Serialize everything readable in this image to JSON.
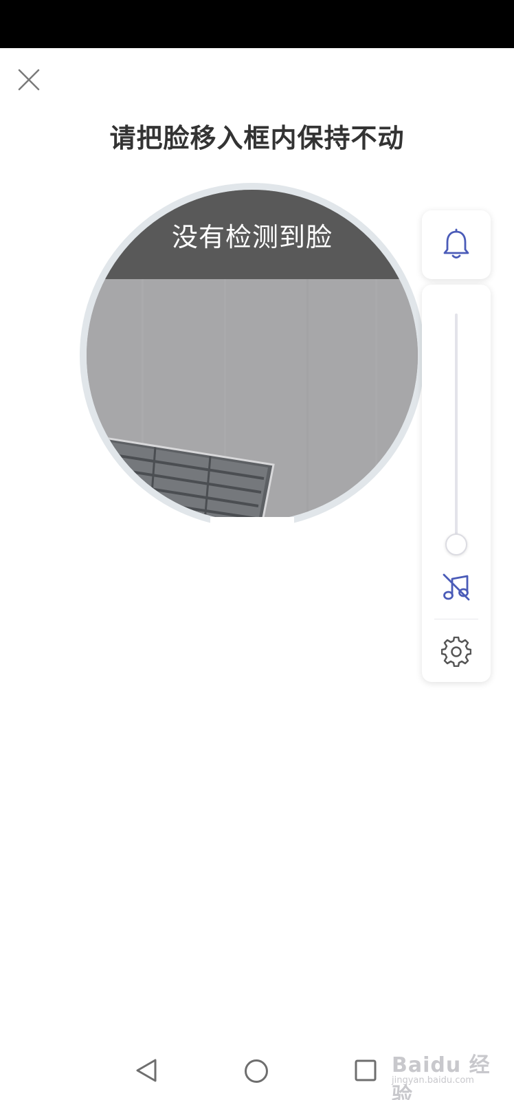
{
  "header": {
    "title": "请把脸移入框内保持不动"
  },
  "face_frame": {
    "status_text": "没有检测到脸"
  },
  "controls": {
    "bell_icon": "bell-icon",
    "volume_level": 0,
    "mute_icon": "music-off-icon",
    "settings_icon": "gear-icon"
  },
  "navigation": {
    "back_icon": "back-triangle-icon",
    "home_icon": "home-circle-icon",
    "recent_icon": "recent-square-icon"
  },
  "watermark": {
    "brand": "Baidu 经验",
    "url": "jingyan.baidu.com"
  },
  "colors": {
    "accent": "#4a5bb8",
    "title": "#333333",
    "banner": "#595959"
  }
}
